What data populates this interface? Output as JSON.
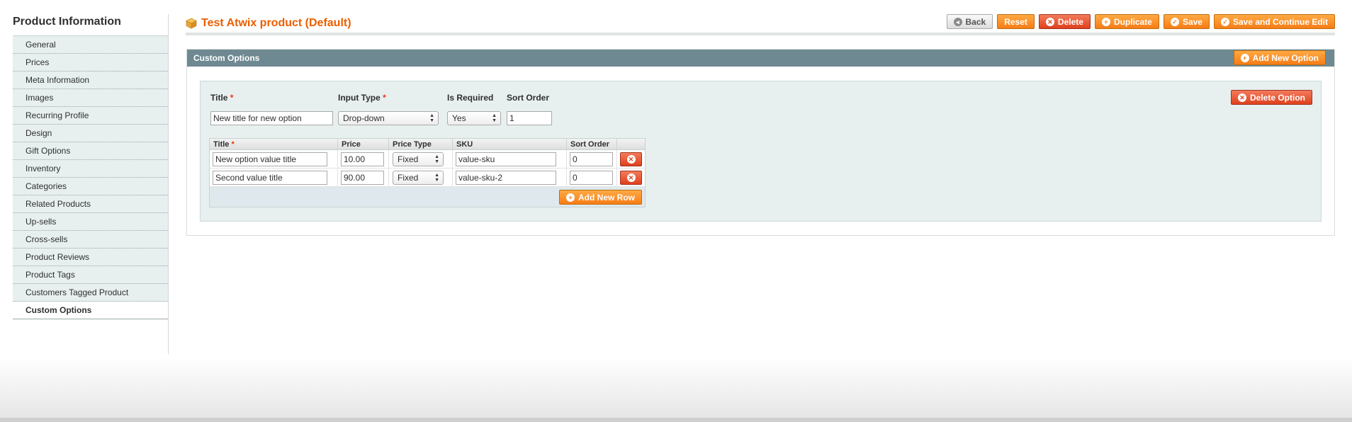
{
  "sidebar": {
    "title": "Product Information",
    "items": [
      {
        "label": "General"
      },
      {
        "label": "Prices"
      },
      {
        "label": "Meta Information"
      },
      {
        "label": "Images"
      },
      {
        "label": "Recurring Profile"
      },
      {
        "label": "Design"
      },
      {
        "label": "Gift Options"
      },
      {
        "label": "Inventory"
      },
      {
        "label": "Categories"
      },
      {
        "label": "Related Products"
      },
      {
        "label": "Up-sells"
      },
      {
        "label": "Cross-sells"
      },
      {
        "label": "Product Reviews"
      },
      {
        "label": "Product Tags"
      },
      {
        "label": "Customers Tagged Product"
      },
      {
        "label": "Custom Options"
      }
    ],
    "active_item": "Custom Options"
  },
  "header": {
    "title": "Test Atwix product (Default)",
    "buttons": {
      "back": "Back",
      "reset": "Reset",
      "delete": "Delete",
      "duplicate": "Duplicate",
      "save": "Save",
      "save_continue": "Save and Continue Edit"
    }
  },
  "section": {
    "title": "Custom Options",
    "add_new_option": "Add New Option",
    "option": {
      "title_label": "Title",
      "input_type_label": "Input Type",
      "is_required_label": "Is Required",
      "sort_order_label": "Sort Order",
      "required_marker": "*",
      "title_value": "New title for new option",
      "input_type_value": "Drop-down",
      "is_required_value": "Yes",
      "sort_order_value": "1",
      "delete_option": "Delete Option",
      "values_table": {
        "headers": {
          "title": "Title",
          "price": "Price",
          "price_type": "Price Type",
          "sku": "SKU",
          "sort_order": "Sort Order"
        },
        "rows": [
          {
            "title": "New option value title",
            "price": "10.00",
            "price_type": "Fixed",
            "sku": "value-sku",
            "sort_order": "0"
          },
          {
            "title": "Second value title",
            "price": "90.00",
            "price_type": "Fixed",
            "sku": "value-sku-2",
            "sort_order": "0"
          }
        ],
        "add_new_row": "Add New Row"
      }
    }
  },
  "colors": {
    "accent_orange": "#f77c16",
    "delete_red": "#e0401c",
    "section_header": "#6f8992",
    "title_orange": "#eb5e00"
  }
}
